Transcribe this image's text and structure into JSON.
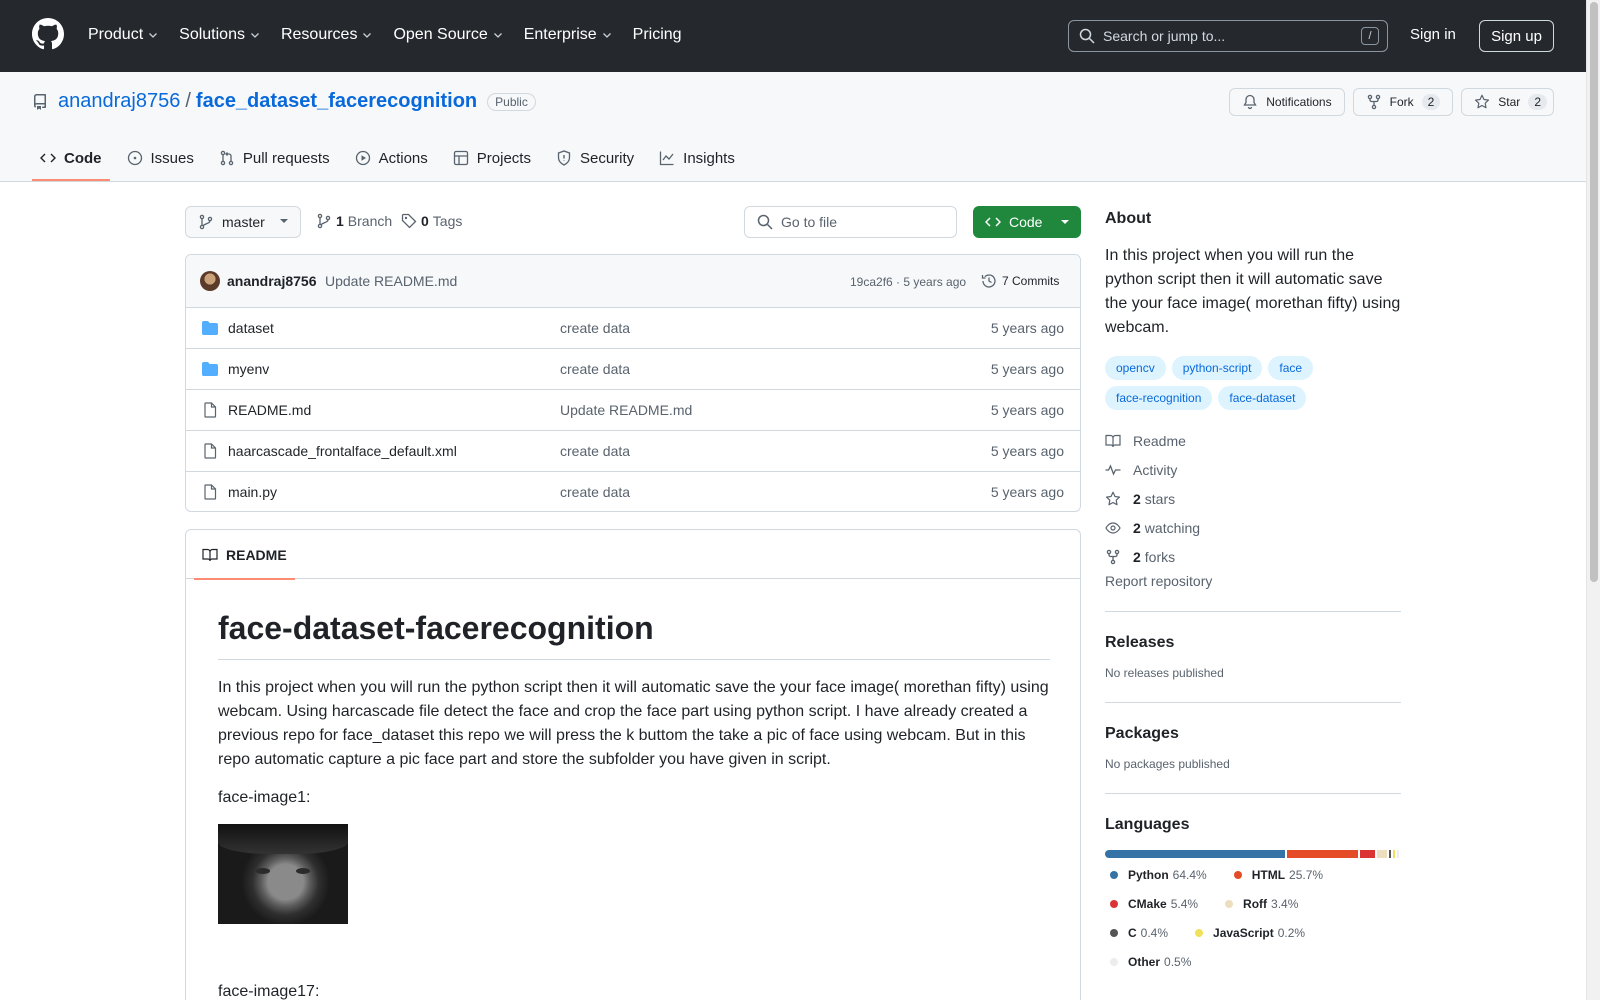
{
  "nav": {
    "items": [
      "Product",
      "Solutions",
      "Resources",
      "Open Source",
      "Enterprise",
      "Pricing"
    ],
    "search_placeholder": "Search or jump to...",
    "search_shortcut": "/",
    "sign_in": "Sign in",
    "sign_up": "Sign up"
  },
  "repo": {
    "owner": "anandraj8756",
    "separator": "/",
    "name": "face_dataset_facerecognition",
    "visibility": "Public",
    "notifications_label": "Notifications",
    "fork_label": "Fork",
    "fork_count": "2",
    "star_label": "Star",
    "star_count": "2",
    "tabs": [
      "Code",
      "Issues",
      "Pull requests",
      "Actions",
      "Projects",
      "Security",
      "Insights"
    ]
  },
  "toolbar": {
    "branch": "master",
    "branch_count": "1",
    "branch_label": "Branch",
    "tag_count": "0",
    "tag_label": "Tags",
    "goto_placeholder": "Go to file",
    "code_label": "Code"
  },
  "commit": {
    "author": "anandraj8756",
    "message": "Update README.md",
    "hash_age": "19ca2f6 · 5 years ago",
    "commits_label": "7 Commits"
  },
  "files": [
    {
      "name": "dataset",
      "type": "folder",
      "message": "create data",
      "age": "5 years ago"
    },
    {
      "name": "myenv",
      "type": "folder",
      "message": "create data",
      "age": "5 years ago"
    },
    {
      "name": "README.md",
      "type": "file",
      "message": "Update README.md",
      "age": "5 years ago"
    },
    {
      "name": "haarcascade_frontalface_default.xml",
      "type": "file",
      "message": "create data",
      "age": "5 years ago"
    },
    {
      "name": "main.py",
      "type": "file",
      "message": "create data",
      "age": "5 years ago"
    }
  ],
  "readme": {
    "tab_label": "README",
    "title": "face-dataset-facerecognition",
    "paragraph": "In this project when you will run the python script then it will automatic save the your face image( morethan fifty) using webcam. Using harcascade file detect the face and crop the face part using python script. I have already created a previous repo for face_dataset this repo we will press the k buttom the take a pic of face using webcam. But in this repo automatic capture a pic face part and store the subfolder you have given in script.",
    "image1_label": "face-image1:",
    "image2_label": "face-image17:"
  },
  "about": {
    "title": "About",
    "description": "In this project when you will run the python script then it will automatic save the your face image( morethan fifty) using webcam.",
    "topics": [
      "opencv",
      "python-script",
      "face",
      "face-recognition",
      "face-dataset"
    ],
    "links": [
      {
        "icon": "book-icon",
        "count": "",
        "label": "Readme"
      },
      {
        "icon": "pulse-icon",
        "count": "",
        "label": "Activity"
      },
      {
        "icon": "star-icon",
        "count": "2",
        "label": "stars"
      },
      {
        "icon": "eye-icon",
        "count": "2",
        "label": "watching"
      },
      {
        "icon": "fork-icon",
        "count": "2",
        "label": "forks"
      }
    ],
    "report": "Report repository"
  },
  "releases": {
    "title": "Releases",
    "text": "No releases published"
  },
  "packages": {
    "title": "Packages",
    "text": "No packages published"
  },
  "languages": {
    "title": "Languages",
    "items": [
      {
        "name": "Python",
        "pct": "64.4%",
        "value": 64.4,
        "color": "#3572A5"
      },
      {
        "name": "HTML",
        "pct": "25.7%",
        "value": 25.7,
        "color": "#e34c26"
      },
      {
        "name": "CMake",
        "pct": "5.4%",
        "value": 5.4,
        "color": "#DA3434"
      },
      {
        "name": "Roff",
        "pct": "3.4%",
        "value": 3.4,
        "color": "#ecdebe"
      },
      {
        "name": "C",
        "pct": "0.4%",
        "value": 0.4,
        "color": "#555555"
      },
      {
        "name": "JavaScript",
        "pct": "0.2%",
        "value": 0.2,
        "color": "#f1e05a"
      },
      {
        "name": "Other",
        "pct": "0.5%",
        "value": 0.5,
        "color": "#ededed"
      }
    ]
  }
}
